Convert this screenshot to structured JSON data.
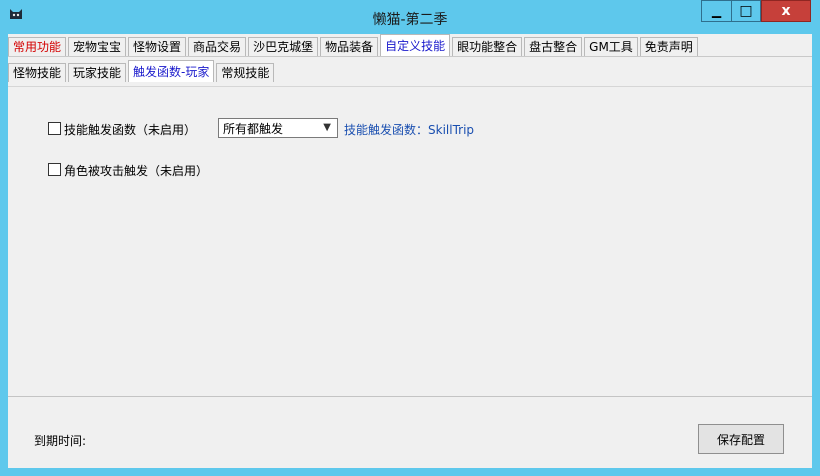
{
  "window": {
    "title": "懒猫-第二季",
    "controls": {
      "minimize": "▁",
      "maximize": "□",
      "close": "x"
    }
  },
  "tabs_primary": [
    {
      "label": "常用功能",
      "state": "red"
    },
    {
      "label": "宠物宝宝",
      "state": "normal"
    },
    {
      "label": "怪物设置",
      "state": "normal"
    },
    {
      "label": "商品交易",
      "state": "normal"
    },
    {
      "label": "沙巴克城堡",
      "state": "normal"
    },
    {
      "label": "物品装备",
      "state": "normal"
    },
    {
      "label": "自定义技能",
      "state": "selected"
    },
    {
      "label": "眼功能整合",
      "state": "normal"
    },
    {
      "label": "盘古整合",
      "state": "normal"
    },
    {
      "label": "GM工具",
      "state": "normal"
    },
    {
      "label": "免责声明",
      "state": "normal"
    }
  ],
  "tabs_secondary": [
    {
      "label": "怪物技能",
      "state": "normal"
    },
    {
      "label": "玩家技能",
      "state": "normal"
    },
    {
      "label": "触发函数-玩家",
      "state": "selected"
    },
    {
      "label": "常规技能",
      "state": "normal"
    }
  ],
  "panel": {
    "skill_trigger": {
      "label": "技能触发函数（未启用）",
      "checked": false,
      "select_value": "所有都触发",
      "hint": "技能触发函数：SkillTrip"
    },
    "role_attacked": {
      "label": "角色被攻击触发（未启用）",
      "checked": false
    }
  },
  "footer": {
    "expire_label": "到期时间:",
    "save_button": "保存配置"
  },
  "colors": {
    "titlebar": "#5ec8ec",
    "close_button": "#c6403a",
    "selected_tab_text": "#1a1acc",
    "red_tab_text": "#d40000",
    "link_text": "#1a4fb0"
  }
}
